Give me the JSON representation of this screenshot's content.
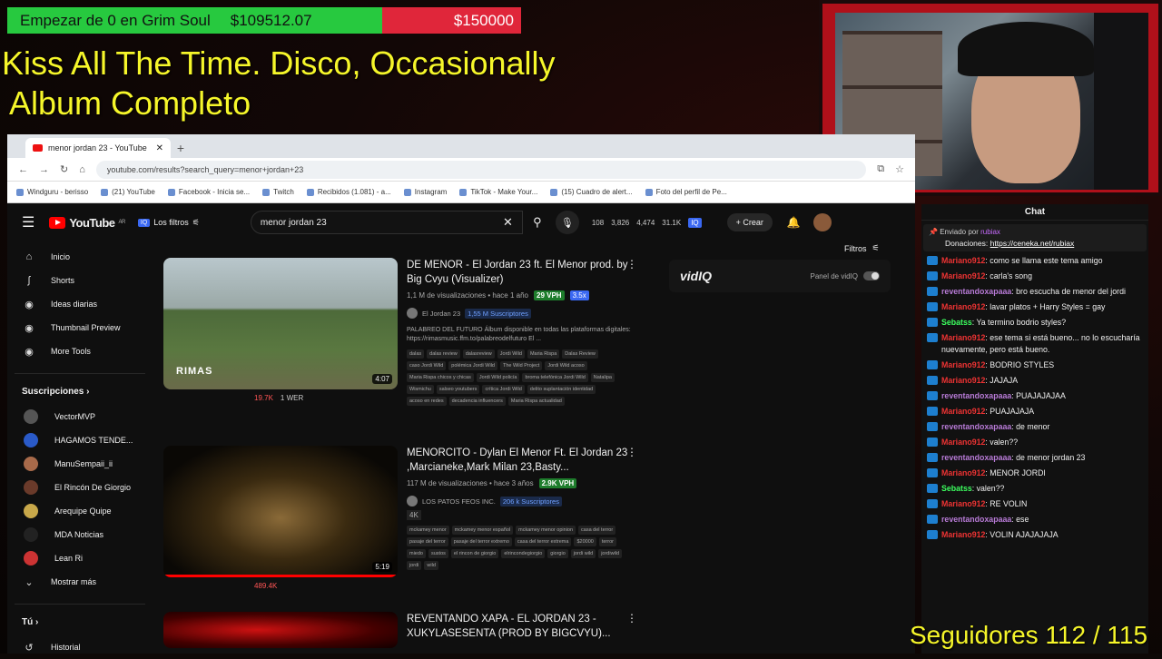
{
  "goal": {
    "title": "Empezar de 0 en Grim Soul",
    "current": "$109512.07",
    "target": "$150000",
    "progress": 0.73
  },
  "song": {
    "line1": "Kiss All The Time. Disco, Occasionally",
    "line2": "Album Completo"
  },
  "browser": {
    "tab_title": "menor jordan 23 - YouTube",
    "url": "youtube.com/results?search_query=menor+jordan+23",
    "bookmarks": [
      "Windguru - berisso",
      "(21) YouTube",
      "Facebook - Inicia se...",
      "Twitch",
      "Recibidos (1.081) - a...",
      "Instagram",
      "TikTok - Make Your...",
      "(15) Cuadro de alert...",
      "Foto del perfil de Pe..."
    ]
  },
  "yt": {
    "logo": "YouTube",
    "region": "AR",
    "filters_label": "Los filtros",
    "search_value": "menor jordan 23",
    "stats": [
      "108",
      "3,826",
      "4,474",
      "31.1K"
    ],
    "create_label": "Crear",
    "filtros": "Filtros",
    "vidiq_brand": "vidIQ",
    "vidiq_panel": "Panel de vidIQ",
    "sidebar": [
      {
        "label": "Inicio",
        "icon": "home-icon"
      },
      {
        "label": "Shorts",
        "icon": "shorts-icon"
      },
      {
        "label": "Ideas diarias",
        "icon": "ideas-icon"
      },
      {
        "label": "Thumbnail Preview",
        "icon": "thumbnail-icon"
      },
      {
        "label": "More Tools",
        "icon": "tools-icon"
      }
    ],
    "subs_title": "Suscripciones",
    "subs": [
      "VectorMVP",
      "HAGAMOS TENDE...",
      "ManuSempaii_ii",
      "El Rincón De Giorgio",
      "Arequipe Quipe",
      "MDA Noticias",
      "Lean Ri",
      "Mostrar más"
    ],
    "you_label": "Tú",
    "history_label": "Historial",
    "videos": [
      {
        "title": "DE MENOR - El Jordan 23 ft. El Menor prod. by Big Cvyu (Visualizer)",
        "meta": "1,1 M de visualizaciones • hace 1 año",
        "vph": "29 VPH",
        "vph2": "3.5x",
        "channel": "El Jordan 23",
        "subs": "1,55 M Suscriptores",
        "desc": "PALABREO DEL FUTURO Álbum disponible en todas las plataformas digitales: https://rimasmusic.ffm.to/palabreodelfuturo El ...",
        "tags": [
          "dalas",
          "dalas review",
          "dalasreview",
          "Jordi Wild",
          "Maria Rispa",
          "Dalas Review",
          "caso Jordi Wild",
          "polémica Jordi Wild",
          "The Wild Project",
          "Jordi Wild acoso",
          "Maria Rispa chicos y chicas",
          "Jordi Wild policía",
          "broma telefónica Jordi Wild",
          "Natalipa",
          "Wismichu",
          "salseo youtubers",
          "crítica Jordi Wild",
          "delito suplantación identidad",
          "acoso en redes",
          "decadencia influencers",
          "Maria Rispa actualidad"
        ],
        "duration": "4:07",
        "views": "19.7K",
        "w": "1 WER",
        "brand": "RIMAS"
      },
      {
        "title": "MENORCITO - Dylan El Menor Ft. El Jordan 23 ,Marcianeke,Mark Milan 23,Basty...",
        "meta": "117 M de visualizaciones • hace 3 años",
        "vph": "2.9K VPH",
        "channel": "LOS PATOS FEOS INC.",
        "subs": "206 k Suscriptores",
        "quality": "4K",
        "tags": [
          "mckamey menor",
          "mckamey menor español",
          "mckamey menor opinion",
          "casa del terror",
          "pasaje del terror",
          "pasaje del terror extremo",
          "casa del terror extrema",
          "$20000",
          "terror",
          "miedo",
          "sustos",
          "el rincon de giorgio",
          "elrincondegiorgio",
          "giorgio",
          "jordi wild",
          "jordiwild",
          "jordi",
          "wild"
        ],
        "duration": "5:19",
        "views": "489.4K"
      },
      {
        "title": "REVENTANDO XAPA - EL JORDAN 23 - XUKYLASESENTA (PROD BY BIGCVYU)..."
      }
    ]
  },
  "chat": {
    "title": "Chat",
    "pinned_by": "Enviado por",
    "pinned_user": "rubiax",
    "pinned_text": "Donaciones:",
    "pinned_link": "https://ceneka.net/rubiax",
    "messages": [
      {
        "u": "Mariano912",
        "c": "u1",
        "t": "como se llama este tema amigo"
      },
      {
        "u": "Mariano912",
        "c": "u1",
        "t": "carla's song"
      },
      {
        "u": "reventandoxapaaa",
        "c": "u2",
        "t": "bro escucha de menor del jordi"
      },
      {
        "u": "Mariano912",
        "c": "u1",
        "t": "lavar platos + Harry Styles = gay"
      },
      {
        "u": "Sebatss",
        "c": "u4",
        "t": "Ya termino bodrio styles?"
      },
      {
        "u": "Mariano912",
        "c": "u1",
        "t": "ese tema si está bueno... no lo escucharía nuevamente, pero está bueno."
      },
      {
        "u": "Mariano912",
        "c": "u1",
        "t": "BODRIO STYLES"
      },
      {
        "u": "Mariano912",
        "c": "u1",
        "t": "JAJAJA"
      },
      {
        "u": "reventandoxapaaa",
        "c": "u2",
        "t": "PUAJAJAJAA"
      },
      {
        "u": "Mariano912",
        "c": "u1",
        "t": "PUAJAJAJA"
      },
      {
        "u": "reventandoxapaaa",
        "c": "u2",
        "t": "de menor"
      },
      {
        "u": "Mariano912",
        "c": "u1",
        "t": "valen??"
      },
      {
        "u": "reventandoxapaaa",
        "c": "u2",
        "t": "de menor jordan 23"
      },
      {
        "u": "Mariano912",
        "c": "u1",
        "t": "MENOR JORDI"
      },
      {
        "u": "Sebatss",
        "c": "u4",
        "t": "valen??"
      },
      {
        "u": "Mariano912",
        "c": "u1",
        "t": "RE VOLIN"
      },
      {
        "u": "reventandoxapaaa",
        "c": "u2",
        "t": "ese"
      },
      {
        "u": "Mariano912",
        "c": "u1",
        "t": "VOLIN AJAJAJAJA"
      }
    ]
  },
  "followers": "Seguidores 112 / 115"
}
